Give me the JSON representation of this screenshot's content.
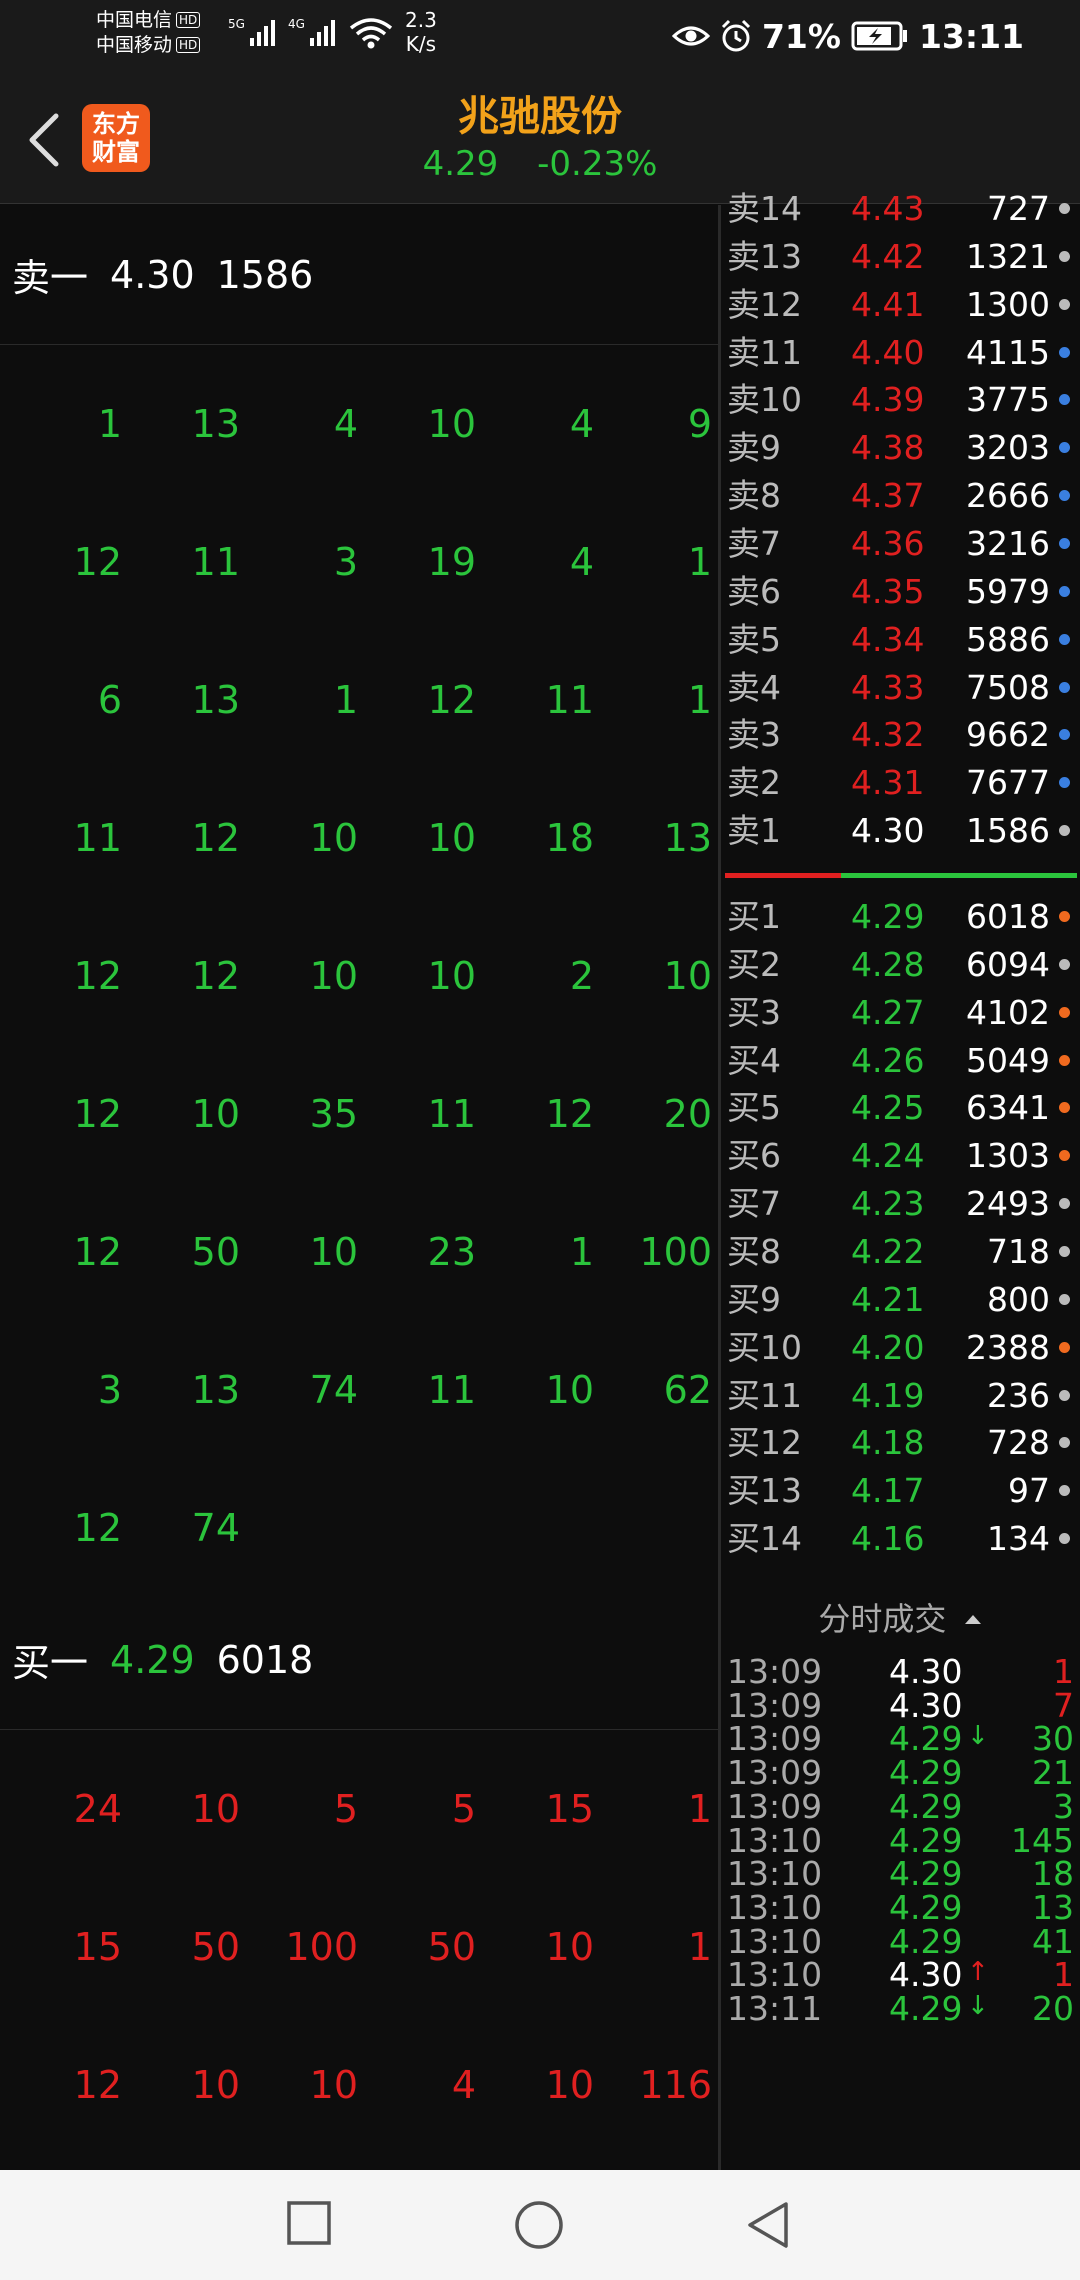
{
  "status_bar": {
    "carrier1": "中国电信",
    "carrier2": "中国移动",
    "hd": "HD",
    "net1": "5G",
    "net2": "4G",
    "speed_value": "2.3",
    "speed_unit": "K/s",
    "battery": "71%",
    "time": "13:11"
  },
  "header": {
    "logo_line1": "东方",
    "logo_line2": "财富",
    "stock_name": "兆驰股份",
    "price": "4.29",
    "change": "-0.23%"
  },
  "left": {
    "sell_head": {
      "label": "卖一",
      "price": "4.30",
      "volume": "1586"
    },
    "sell_queue": [
      [
        "1",
        "13",
        "4",
        "10",
        "4",
        "9"
      ],
      [
        "12",
        "11",
        "3",
        "19",
        "4",
        "1"
      ],
      [
        "6",
        "13",
        "1",
        "12",
        "11",
        "1"
      ],
      [
        "11",
        "12",
        "10",
        "10",
        "18",
        "13"
      ],
      [
        "12",
        "12",
        "10",
        "10",
        "2",
        "10"
      ],
      [
        "12",
        "10",
        "35",
        "11",
        "12",
        "20"
      ],
      [
        "12",
        "50",
        "10",
        "23",
        "1",
        "100"
      ],
      [
        "3",
        "13",
        "74",
        "11",
        "10",
        "62"
      ],
      [
        "12",
        "74",
        "",
        "",
        "",
        ""
      ]
    ],
    "buy_head": {
      "label": "买一",
      "price": "4.29",
      "volume": "6018"
    },
    "buy_queue": [
      [
        "24",
        "10",
        "5",
        "5",
        "15",
        "1"
      ],
      [
        "15",
        "50",
        "100",
        "50",
        "10",
        "1"
      ],
      [
        "12",
        "10",
        "10",
        "4",
        "10",
        "116"
      ]
    ]
  },
  "order_book": {
    "asks": [
      {
        "label": "卖14",
        "price": "4.43",
        "volume": "727",
        "dot": "gray"
      },
      {
        "label": "卖13",
        "price": "4.42",
        "volume": "1321",
        "dot": "gray"
      },
      {
        "label": "卖12",
        "price": "4.41",
        "volume": "1300",
        "dot": "gray"
      },
      {
        "label": "卖11",
        "price": "4.40",
        "volume": "4115",
        "dot": "blue"
      },
      {
        "label": "卖10",
        "price": "4.39",
        "volume": "3775",
        "dot": "blue"
      },
      {
        "label": "卖9",
        "price": "4.38",
        "volume": "3203",
        "dot": "blue"
      },
      {
        "label": "卖8",
        "price": "4.37",
        "volume": "2666",
        "dot": "blue"
      },
      {
        "label": "卖7",
        "price": "4.36",
        "volume": "3216",
        "dot": "blue"
      },
      {
        "label": "卖6",
        "price": "4.35",
        "volume": "5979",
        "dot": "blue"
      },
      {
        "label": "卖5",
        "price": "4.34",
        "volume": "5886",
        "dot": "blue"
      },
      {
        "label": "卖4",
        "price": "4.33",
        "volume": "7508",
        "dot": "blue"
      },
      {
        "label": "卖3",
        "price": "4.32",
        "volume": "9662",
        "dot": "blue"
      },
      {
        "label": "卖2",
        "price": "4.31",
        "volume": "7677",
        "dot": "blue"
      },
      {
        "label": "卖1",
        "price": "4.30",
        "volume": "1586",
        "dot": "gray"
      }
    ],
    "bids": [
      {
        "label": "买1",
        "price": "4.29",
        "volume": "6018",
        "dot": "orange"
      },
      {
        "label": "买2",
        "price": "4.28",
        "volume": "6094",
        "dot": "gray"
      },
      {
        "label": "买3",
        "price": "4.27",
        "volume": "4102",
        "dot": "orange"
      },
      {
        "label": "买4",
        "price": "4.26",
        "volume": "5049",
        "dot": "orange"
      },
      {
        "label": "买5",
        "price": "4.25",
        "volume": "6341",
        "dot": "orange"
      },
      {
        "label": "买6",
        "price": "4.24",
        "volume": "1303",
        "dot": "orange"
      },
      {
        "label": "买7",
        "price": "4.23",
        "volume": "2493",
        "dot": "gray"
      },
      {
        "label": "买8",
        "price": "4.22",
        "volume": "718",
        "dot": "gray"
      },
      {
        "label": "买9",
        "price": "4.21",
        "volume": "800",
        "dot": "gray"
      },
      {
        "label": "买10",
        "price": "4.20",
        "volume": "2388",
        "dot": "orange"
      },
      {
        "label": "买11",
        "price": "4.19",
        "volume": "236",
        "dot": "gray"
      },
      {
        "label": "买12",
        "price": "4.18",
        "volume": "728",
        "dot": "gray"
      },
      {
        "label": "买13",
        "price": "4.17",
        "volume": "97",
        "dot": "gray"
      },
      {
        "label": "买14",
        "price": "4.16",
        "volume": "134",
        "dot": "gray"
      }
    ]
  },
  "time_sales": {
    "title": "分时成交",
    "rows": [
      {
        "time": "13:09",
        "price": "4.30",
        "arrow": "",
        "volume": "1",
        "price_color": "white",
        "vol_color": "red"
      },
      {
        "time": "13:09",
        "price": "4.30",
        "arrow": "",
        "volume": "7",
        "price_color": "white",
        "vol_color": "red"
      },
      {
        "time": "13:09",
        "price": "4.29",
        "arrow": "↓",
        "volume": "30",
        "price_color": "green",
        "vol_color": "green"
      },
      {
        "time": "13:09",
        "price": "4.29",
        "arrow": "",
        "volume": "21",
        "price_color": "green",
        "vol_color": "green"
      },
      {
        "time": "13:09",
        "price": "4.29",
        "arrow": "",
        "volume": "3",
        "price_color": "green",
        "vol_color": "green"
      },
      {
        "time": "13:10",
        "price": "4.29",
        "arrow": "",
        "volume": "145",
        "price_color": "green",
        "vol_color": "green"
      },
      {
        "time": "13:10",
        "price": "4.29",
        "arrow": "",
        "volume": "18",
        "price_color": "green",
        "vol_color": "green"
      },
      {
        "time": "13:10",
        "price": "4.29",
        "arrow": "",
        "volume": "13",
        "price_color": "green",
        "vol_color": "green"
      },
      {
        "time": "13:10",
        "price": "4.29",
        "arrow": "",
        "volume": "41",
        "price_color": "green",
        "vol_color": "green"
      },
      {
        "time": "13:10",
        "price": "4.30",
        "arrow": "↑",
        "volume": "1",
        "price_color": "white",
        "vol_color": "red"
      },
      {
        "time": "13:11",
        "price": "4.29",
        "arrow": "↓",
        "volume": "20",
        "price_color": "green",
        "vol_color": "green"
      }
    ]
  },
  "colors": {
    "red": "#e02020",
    "green": "#2bc43c",
    "blue": "#3a7fe0",
    "orange": "#f06a1f",
    "gray": "#bbbbbb",
    "white": "#ffffff"
  }
}
